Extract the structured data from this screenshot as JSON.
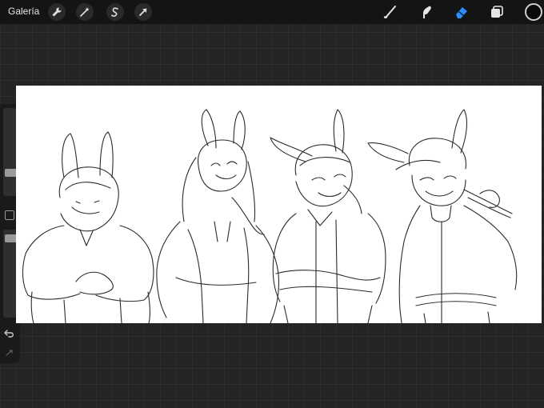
{
  "topbar": {
    "gallery_label": "Galería",
    "left_tools": [
      "wrench-icon",
      "magic-wand-icon",
      "selection-icon",
      "transform-arrow-icon"
    ],
    "right_tools": [
      "brush-icon",
      "smudge-icon",
      "eraser-icon",
      "layers-icon"
    ],
    "active_tool": "eraser-icon",
    "accent_color": "#2b8cff",
    "current_color": "#0a0a0a"
  },
  "sidebar": {
    "brush_size_level": 0.7,
    "opacity_level": 0.3,
    "buttons": [
      "modify-button",
      "undo-icon",
      "redo-icon"
    ]
  },
  "canvas": {
    "background": "#ffffff",
    "content": "sketch"
  }
}
